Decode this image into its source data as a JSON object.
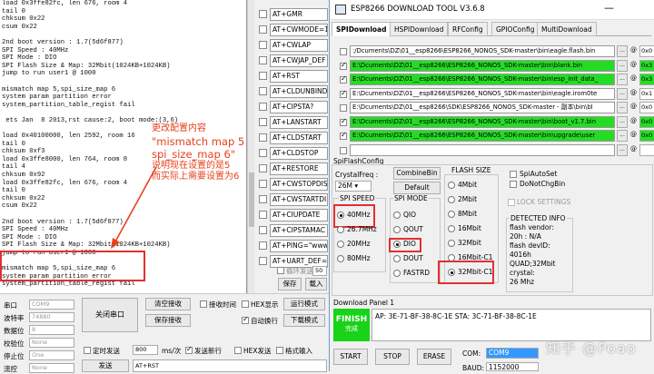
{
  "terminal": {
    "lines": [
      "load 0x3ffe82fc, len 676, room 4",
      "tail 0",
      "chksum 0x22",
      "csum 0x22",
      "",
      "2nd boot version : 1.7(5d6f877)",
      "SPI Speed : 40MHz",
      "SPI Mode : DIO",
      "SPI Flash Size & Map: 32Mbit(1024KB+1024KB)",
      "jump to run user1 @ 1000",
      "",
      "mismatch map 5,spi_size_map 6",
      "system param partition error",
      "system_partition_table_regist fail",
      "",
      " ets Jan  8 2013,rst cause:2, boot mode:(3,6)",
      "",
      "load 0x40100000, len 2592, room 16",
      "tail 0",
      "chksum 0xf3",
      "load 0x3ffe8000, len 764, room 8",
      "tail 4",
      "chksum 0x92",
      "load 0x3ffe82fc, len 676, room 4",
      "tail 0",
      "chksum 0x22",
      "csum 0x22",
      "",
      "2nd boot version : 1.7(5d6f877)",
      "SPI Speed : 40MHz",
      "SPI Mode : DIO",
      "SPI Flash Size & Map: 32Mbit(1024KB+1024KB)",
      "jump to run user1 @ 1000",
      "",
      "mismatch map 5,spi_size_map 6",
      "system param partition error",
      "system_partition_table_regist fail"
    ],
    "annotation": {
      "line1": "更改配置内容",
      "line2": "\"mismatch map 5",
      "line3": "spi_size_map 6\"",
      "line4": "说明现在设置的是5",
      "line5": "而实际上需要设置为6"
    }
  },
  "commands": [
    "AT+GMR",
    "AT+CWMODE=1",
    "AT+CWLAP",
    "AT+CWJAP_DEF",
    "AT+RST",
    "AT+CLDUNBIND",
    "AT+CIPSTA?",
    "AT+LANSTART",
    "AT+CLDSTART",
    "AT+CLDSTOP",
    "AT+RESTORE",
    "AT+CWSTOPDIS",
    "AT+CWSTARTDI",
    "AT+CIUPDATE",
    "AT+CIPSTAMAC",
    "AT+PING=\"www",
    "AT+UART_DEF="
  ],
  "bottom": {
    "loop_label": "循环发送",
    "loop_value": "50",
    "save_btn": "保存",
    "load_btn": "载入",
    "port_label": "串口",
    "port_value": "COM9",
    "baud_label": "波特率",
    "baud_value": "74880",
    "data_label": "数据位",
    "data_value": "8",
    "parity_label": "校验位",
    "parity_value": "None",
    "stop_label": "停止位",
    "stop_value": "One",
    "flow_label": "流控",
    "flow_value": "None",
    "close_port_btn": "关闭串口",
    "clear_recv_btn": "清空接收",
    "save_recv_btn": "保存接收",
    "recv_time": "接收时间",
    "hex_show": "HEX显示",
    "run_mode_btn": "运行模式",
    "auto_newline": "自动换行",
    "download_mode_btn": "下载模式",
    "timed_send": "定时发送",
    "interval_value": "800",
    "interval_unit": "ms/次",
    "send_newline": "发送新行",
    "hex_send": "HEX发送",
    "format_input": "格式输入",
    "send_btn": "发送",
    "send_text": "AT+RST"
  },
  "tool": {
    "title": "ESP8266 DOWNLOAD TOOL V3.6.8",
    "minimize": "—",
    "tabs": [
      "SPIDownload",
      "HSPIDownload",
      "RFConfig",
      "GPIOConfig",
      "MultiDownload"
    ],
    "files": [
      {
        "path": ":/Dcuments\\DZ\\01__esp8266\\ESP8266_NONOS_SDK-master\\bin\\eagle.flash.bin",
        "addr": "0x0"
      },
      {
        "path": "E:\\Dcuments\\DZ\\01__esp8266\\ESP8266_NONOS_SDK-master\\bin\\blank.bin",
        "addr": "0x3"
      },
      {
        "path": "E:\\Dcuments\\DZ\\01__esp8266\\ESP8266_NONOS_SDK-master\\bin\\esp_init_data_",
        "addr": "0x3"
      },
      {
        "path": "E:\\Dcuments\\DZ\\01__esp8266\\ESP8266_NONOS_SDK-master\\bin\\eagle.irom0te",
        "addr": "0x1"
      },
      {
        "path": "E:\\Dcuments\\DZ\\01__esp8266\\SDK\\ESP8266_NONOS_SDK-master - 副本\\bin\\bl",
        "addr": "0x0"
      },
      {
        "path": "E:\\Dcuments\\DZ\\01__esp8266\\ESP8266_NONOS_SDK-master\\bin\\boot_v1.7.bin",
        "addr": "0x0"
      },
      {
        "path": "E:\\Dcuments\\DZ\\01__esp8266\\ESP8266_NONOS_SDK-master\\bin\\upgrade\\user",
        "addr": "0x0"
      },
      {
        "path": "",
        "addr": ""
      }
    ],
    "spiflash_label": "SpiFlashConfig",
    "crystal_label": "CrystalFreq :",
    "crystal_value": "26M",
    "combine_btn": "CombineBin",
    "default_btn": "Default",
    "flash_size_label": "FLASH SIZE",
    "spi_speed_label": "SPI SPEED",
    "spi_mode_label": "SPI MODE",
    "spi_speed": [
      "40MHz",
      "26.7MHz",
      "20MHz",
      "80MHz"
    ],
    "spi_mode": [
      "QIO",
      "QOUT",
      "DIO",
      "DOUT",
      "FASTRD"
    ],
    "flash_size_a": [
      "4Mbit",
      "2Mbit",
      "8Mbit",
      "16Mbit",
      "32Mbit"
    ],
    "flash_size_b": [
      "16Mbit-C1",
      "32Mbit-C1"
    ],
    "spi_autoset": "SpiAutoSet",
    "donotchgbin": "DoNotChgBin",
    "lock_settings": "LOCK SETTINGS",
    "detected_label": "DETECTED INFO",
    "detected_lines": [
      "flash vendor:",
      "20h : N/A",
      "flash devID:",
      "4016h",
      "QUAD;32Mbit",
      "crystal:",
      "26 Mhz"
    ],
    "download_panel": "Download Panel 1",
    "finish": "FINISH",
    "finish_sub": "完成",
    "mac_info": "AP:  3E-71-BF-38-8C-1E  STA:  3C-71-BF-38-8C-1E",
    "start_btn": "START",
    "stop_btn": "STOP",
    "erase_btn": "ERASE",
    "com_label": "COM:",
    "com_value": "COM9",
    "baud_label": "BAUD:",
    "baud_value": "1152000"
  },
  "watermark": "知乎 @Poao"
}
